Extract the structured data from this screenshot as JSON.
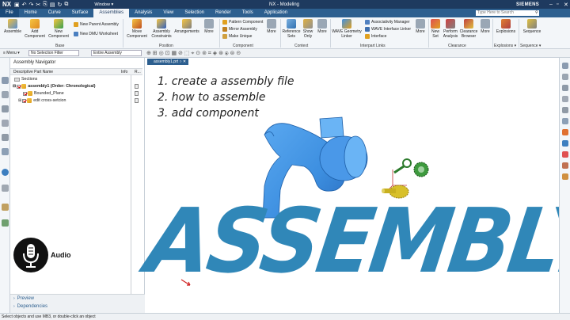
{
  "titlebar": {
    "logo": "NX",
    "window_menu": "Window ▾",
    "app_title": "NX - Modeling",
    "brand": "SIEMENS"
  },
  "menu": {
    "tabs": [
      "File",
      "Home",
      "Curve",
      "Surface",
      "Assemblies",
      "Analysis",
      "View",
      "Selection",
      "Render",
      "Tools",
      "Application"
    ],
    "active_tab": "Assemblies",
    "search_placeholder": "Type Here to Search"
  },
  "ribbon": {
    "base": {
      "label": "Base",
      "assemble": "Assemble",
      "add_component": [
        "Add",
        "Component"
      ],
      "new_component": [
        "New",
        "Component"
      ],
      "new_parent_assembly": "New Parent Assembly",
      "new_dmu_worksheet": "New DMU Worksheet"
    },
    "position": {
      "label": "Position",
      "move_component": [
        "Move",
        "Component"
      ],
      "assembly_constraints": [
        "Assembly",
        "Constraints"
      ],
      "arrangements": "Arrangements",
      "more": "More"
    },
    "component": {
      "label": "Component",
      "pattern_component": "Pattern Component",
      "mirror_assembly": "Mirror Assembly",
      "make_unique": "Make Unique",
      "more": "More"
    },
    "context": {
      "label": "Context",
      "reference_sets": [
        "Reference",
        "Sets"
      ],
      "show_only": [
        "Show",
        "Only"
      ],
      "more": "More"
    },
    "interpart": {
      "label": "Interpart Links",
      "wave_geometry_linker": [
        "WAVE Geometry",
        "Linker"
      ],
      "associativity_manager": "Associativity Manager",
      "wave_interface_linker": "WAVE Interface Linker",
      "interface": "Interface",
      "more": "More"
    },
    "clearance": {
      "label": "Clearance",
      "new_set": [
        "New",
        "Set"
      ],
      "perform_analysis": [
        "Perform",
        "Analysis"
      ],
      "clearance_browser": [
        "Clearance",
        "Browser"
      ],
      "more": "More"
    },
    "explosions": {
      "label": "Explosions ▾",
      "explosions": "Explosions"
    },
    "sequence": {
      "label": "Sequence ▾",
      "sequence": "Sequence"
    }
  },
  "toolbar2": {
    "menu": "≡ Menu ▾",
    "selection_filter": "No Selection Filter",
    "scope": "Entire Assembly"
  },
  "navigator": {
    "title": "Assembly Navigator",
    "columns": [
      "Descriptive Part Name",
      "Info",
      "R..."
    ],
    "rows": [
      {
        "label": "Sections",
        "indent": 0
      },
      {
        "label": "assembly1 (Order: Chronological)",
        "indent": 0
      },
      {
        "label": "Bounded_Plane",
        "indent": 1
      },
      {
        "label": "edit cross-setcion",
        "indent": 1
      }
    ],
    "preview": "Preview",
    "dependencies": "Dependencies"
  },
  "audio_label": "Audio",
  "document_tab": "assembly1.prt ○ ✕",
  "notes": [
    "1. create a assembly file",
    "2. how to assemble",
    "3. add component"
  ],
  "big_title": "ASSEMBLY",
  "status": "Select objects and use MB3, or double-click an object",
  "colors": {
    "titlebar": "#1e3a5f",
    "menubar": "#2d5f8f",
    "duct_blue": "#3d8fe0",
    "title_blue": "#3087b8",
    "gear_green": "#3e9a3e",
    "gear_yellow": "#d8c02a"
  }
}
